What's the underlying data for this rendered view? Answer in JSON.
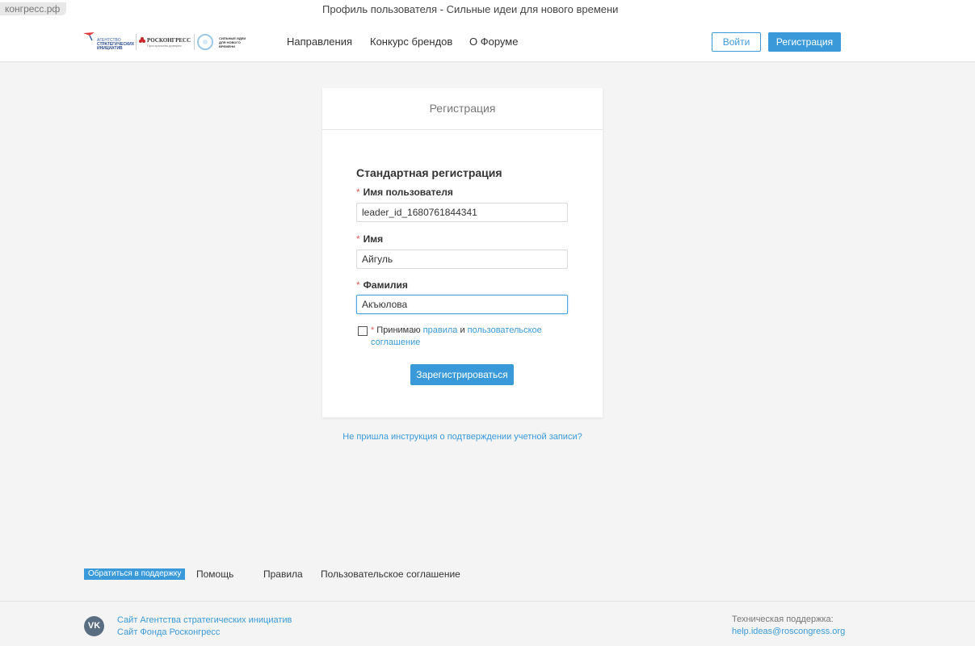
{
  "browser": {
    "tab_label": "конгресс.рф",
    "page_title": "Профиль пользователя - Сильные идеи для нового времени"
  },
  "header": {
    "logos": {
      "asi_line1": "АГЕНТСТВО",
      "asi_line2": "СТРАТЕГИЧЕСКИХ",
      "asi_line3": "ИНИЦИАТИВ",
      "roscongress_name": "РОСКОНГРЕСС",
      "roscongress_tagline": "Пространство доверия",
      "si_line1": "СИЛЬНЫЕ ИДЕИ",
      "si_line2": "ДЛЯ НОВОГО",
      "si_line3": "ВРЕМЕНИ"
    },
    "nav": [
      "Направления",
      "Конкурс брендов",
      "О Форуме"
    ],
    "login_label": "Войти",
    "register_label": "Регистрация"
  },
  "card": {
    "title": "Регистрация",
    "form_title": "Стандартная регистрация",
    "fields": [
      {
        "label": "Имя пользователя",
        "value": "leader_id_1680761844341"
      },
      {
        "label": "Имя",
        "value": "Айгуль"
      },
      {
        "label": "Фамилия",
        "value": "Акъюлова"
      }
    ],
    "required_mark": "*",
    "agree": {
      "prefix": "Принимаю",
      "rules_link": "правила",
      "and": "и",
      "agreement_link": "пользовательское соглашение"
    },
    "submit_label": "Зарегистрироваться"
  },
  "no_instruction_link": "Не пришла инструкция о подтверждении учетной записи?",
  "footer": {
    "support_badge": "Обратиться в поддержку",
    "links": [
      "Помощь",
      "Правила",
      "Пользовательское соглашение"
    ],
    "vk_icon_text": "VK",
    "ext_links": [
      "Сайт Агентства стратегических инициатив",
      "Сайт Фонда Росконгресс"
    ],
    "tech_support_label": "Техническая поддержка:",
    "tech_support_email": "help.ideas@roscongress.org"
  },
  "colors": {
    "accent": "#3a9ad9",
    "required": "#e45b5b",
    "background": "#f4f4f4"
  }
}
